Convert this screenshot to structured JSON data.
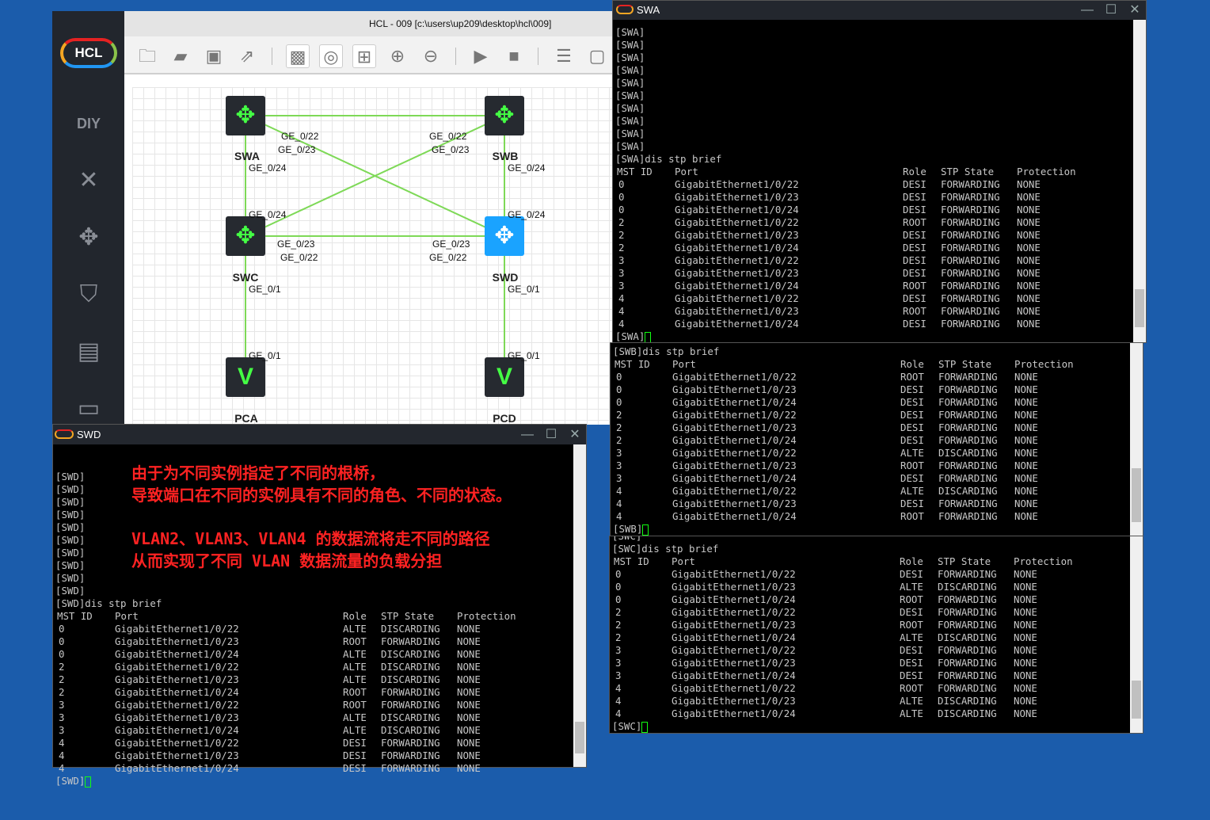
{
  "app": {
    "title": "HCL - 009 [c:\\users\\up209\\desktop\\hcl\\009]",
    "logo_text": "HCL",
    "sidebar_icons": [
      "diy-icon",
      "cable-icon",
      "router-icon",
      "firewall-icon",
      "server-icon",
      "terminal-icon"
    ],
    "toolbar_icons": [
      "new-project-icon",
      "open-folder-icon",
      "save-icon",
      "export-icon",
      "capture-icon",
      "topology-icon",
      "grid-icon",
      "zoom-in-icon",
      "zoom-out-icon",
      "start-icon",
      "stop-icon",
      "list-add-icon",
      "device-add-icon"
    ]
  },
  "topology": {
    "nodes": [
      {
        "name": "SWA"
      },
      {
        "name": "SWB"
      },
      {
        "name": "SWC"
      },
      {
        "name": "SWD"
      },
      {
        "name": "PCA"
      },
      {
        "name": "PCD"
      }
    ],
    "port_labels": [
      "GE_0/22",
      "GE_0/23",
      "GE_0/24",
      "GE_0/22",
      "GE_0/23",
      "GE_0/24",
      "GE_0/24",
      "GE_0/23",
      "GE_0/22",
      "GE_0/1",
      "GE_0/24",
      "GE_0/23",
      "GE_0/22",
      "GE_0/1",
      "GE_0/1",
      "GE_0/1"
    ],
    "link_color": "#7ed957",
    "selected_color": "#1aa3ff"
  },
  "terminals": {
    "header": [
      "MST ID",
      "Port",
      "Role",
      "STP State",
      "Protection"
    ],
    "swa": {
      "title": "SWA",
      "prompts": [
        "[SWA]",
        "[SWA]",
        "[SWA]",
        "[SWA]",
        "[SWA]",
        "[SWA]",
        "[SWA]",
        "[SWA]",
        "[SWA]",
        "[SWA]"
      ],
      "command": "[SWA]dis stp brief",
      "end_prompt": "[SWA]",
      "rows": [
        [
          "0",
          "GigabitEthernet1/0/22",
          "DESI",
          "FORWARDING",
          "NONE"
        ],
        [
          "0",
          "GigabitEthernet1/0/23",
          "DESI",
          "FORWARDING",
          "NONE"
        ],
        [
          "0",
          "GigabitEthernet1/0/24",
          "DESI",
          "FORWARDING",
          "NONE"
        ],
        [
          "2",
          "GigabitEthernet1/0/22",
          "ROOT",
          "FORWARDING",
          "NONE"
        ],
        [
          "2",
          "GigabitEthernet1/0/23",
          "DESI",
          "FORWARDING",
          "NONE"
        ],
        [
          "2",
          "GigabitEthernet1/0/24",
          "DESI",
          "FORWARDING",
          "NONE"
        ],
        [
          "3",
          "GigabitEthernet1/0/22",
          "DESI",
          "FORWARDING",
          "NONE"
        ],
        [
          "3",
          "GigabitEthernet1/0/23",
          "DESI",
          "FORWARDING",
          "NONE"
        ],
        [
          "3",
          "GigabitEthernet1/0/24",
          "ROOT",
          "FORWARDING",
          "NONE"
        ],
        [
          "4",
          "GigabitEthernet1/0/22",
          "DESI",
          "FORWARDING",
          "NONE"
        ],
        [
          "4",
          "GigabitEthernet1/0/23",
          "ROOT",
          "FORWARDING",
          "NONE"
        ],
        [
          "4",
          "GigabitEthernet1/0/24",
          "DESI",
          "FORWARDING",
          "NONE"
        ]
      ]
    },
    "swb": {
      "command": "[SWB]dis stp brief",
      "end_prompt": "[SWB]",
      "rows": [
        [
          "0",
          "GigabitEthernet1/0/22",
          "ROOT",
          "FORWARDING",
          "NONE"
        ],
        [
          "0",
          "GigabitEthernet1/0/23",
          "DESI",
          "FORWARDING",
          "NONE"
        ],
        [
          "0",
          "GigabitEthernet1/0/24",
          "DESI",
          "FORWARDING",
          "NONE"
        ],
        [
          "2",
          "GigabitEthernet1/0/22",
          "DESI",
          "FORWARDING",
          "NONE"
        ],
        [
          "2",
          "GigabitEthernet1/0/23",
          "DESI",
          "FORWARDING",
          "NONE"
        ],
        [
          "2",
          "GigabitEthernet1/0/24",
          "DESI",
          "FORWARDING",
          "NONE"
        ],
        [
          "3",
          "GigabitEthernet1/0/22",
          "ALTE",
          "DISCARDING",
          "NONE"
        ],
        [
          "3",
          "GigabitEthernet1/0/23",
          "ROOT",
          "FORWARDING",
          "NONE"
        ],
        [
          "3",
          "GigabitEthernet1/0/24",
          "DESI",
          "FORWARDING",
          "NONE"
        ],
        [
          "4",
          "GigabitEthernet1/0/22",
          "ALTE",
          "DISCARDING",
          "NONE"
        ],
        [
          "4",
          "GigabitEthernet1/0/23",
          "DESI",
          "FORWARDING",
          "NONE"
        ],
        [
          "4",
          "GigabitEthernet1/0/24",
          "ROOT",
          "FORWARDING",
          "NONE"
        ]
      ]
    },
    "swc": {
      "prev_prompt": "[SWC]",
      "command": "[SWC]dis stp brief",
      "end_prompt": "[SWC]",
      "rows": [
        [
          "0",
          "GigabitEthernet1/0/22",
          "DESI",
          "FORWARDING",
          "NONE"
        ],
        [
          "0",
          "GigabitEthernet1/0/23",
          "ALTE",
          "DISCARDING",
          "NONE"
        ],
        [
          "0",
          "GigabitEthernet1/0/24",
          "ROOT",
          "FORWARDING",
          "NONE"
        ],
        [
          "2",
          "GigabitEthernet1/0/22",
          "DESI",
          "FORWARDING",
          "NONE"
        ],
        [
          "2",
          "GigabitEthernet1/0/23",
          "ROOT",
          "FORWARDING",
          "NONE"
        ],
        [
          "2",
          "GigabitEthernet1/0/24",
          "ALTE",
          "DISCARDING",
          "NONE"
        ],
        [
          "3",
          "GigabitEthernet1/0/22",
          "DESI",
          "FORWARDING",
          "NONE"
        ],
        [
          "3",
          "GigabitEthernet1/0/23",
          "DESI",
          "FORWARDING",
          "NONE"
        ],
        [
          "3",
          "GigabitEthernet1/0/24",
          "DESI",
          "FORWARDING",
          "NONE"
        ],
        [
          "4",
          "GigabitEthernet1/0/22",
          "ROOT",
          "FORWARDING",
          "NONE"
        ],
        [
          "4",
          "GigabitEthernet1/0/23",
          "ALTE",
          "DISCARDING",
          "NONE"
        ],
        [
          "4",
          "GigabitEthernet1/0/24",
          "ALTE",
          "DISCARDING",
          "NONE"
        ]
      ]
    },
    "swd": {
      "title": "SWD",
      "prompts": [
        "[SWD]",
        "[SWD]",
        "[SWD]",
        "[SWD]",
        "[SWD]",
        "[SWD]",
        "[SWD]",
        "[SWD]",
        "[SWD]",
        "[SWD]"
      ],
      "command": "[SWD]dis stp brief",
      "end_prompt": "[SWD]",
      "rows": [
        [
          "0",
          "GigabitEthernet1/0/22",
          "ALTE",
          "DISCARDING",
          "NONE"
        ],
        [
          "0",
          "GigabitEthernet1/0/23",
          "ROOT",
          "FORWARDING",
          "NONE"
        ],
        [
          "0",
          "GigabitEthernet1/0/24",
          "ALTE",
          "DISCARDING",
          "NONE"
        ],
        [
          "2",
          "GigabitEthernet1/0/22",
          "ALTE",
          "DISCARDING",
          "NONE"
        ],
        [
          "2",
          "GigabitEthernet1/0/23",
          "ALTE",
          "DISCARDING",
          "NONE"
        ],
        [
          "2",
          "GigabitEthernet1/0/24",
          "ROOT",
          "FORWARDING",
          "NONE"
        ],
        [
          "3",
          "GigabitEthernet1/0/22",
          "ROOT",
          "FORWARDING",
          "NONE"
        ],
        [
          "3",
          "GigabitEthernet1/0/23",
          "ALTE",
          "DISCARDING",
          "NONE"
        ],
        [
          "3",
          "GigabitEthernet1/0/24",
          "ALTE",
          "DISCARDING",
          "NONE"
        ],
        [
          "4",
          "GigabitEthernet1/0/22",
          "DESI",
          "FORWARDING",
          "NONE"
        ],
        [
          "4",
          "GigabitEthernet1/0/23",
          "DESI",
          "FORWARDING",
          "NONE"
        ],
        [
          "4",
          "GigabitEthernet1/0/24",
          "DESI",
          "FORWARDING",
          "NONE"
        ]
      ],
      "annotations": [
        "由于为不同实例指定了不同的根桥，",
        "导致端口在不同的实例具有不同的角色、不同的状态。",
        "VLAN2、VLAN3、VLAN4 的数据流将走不同的路径",
        "从而实现了不同 VLAN 数据流量的负载分担"
      ],
      "annotation_color": "#ff2222"
    }
  }
}
